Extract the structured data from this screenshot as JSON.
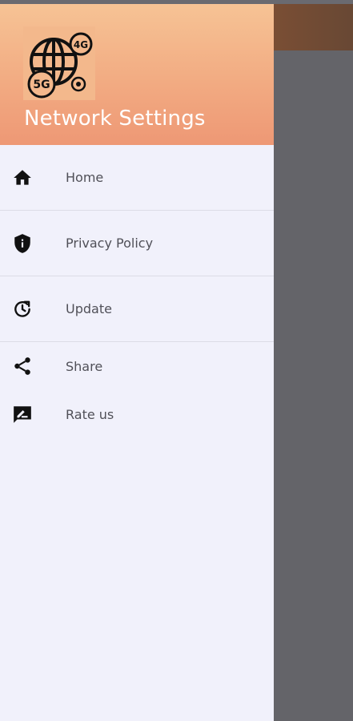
{
  "header": {
    "title": "Network Settings",
    "logo_badges": {
      "top": "4G",
      "bottom": "5G"
    },
    "gradient_top": "#f6c395",
    "gradient_bottom": "#ee9875"
  },
  "menu": {
    "items": [
      {
        "label": "Home",
        "icon": "home-icon"
      },
      {
        "label": "Privacy Policy",
        "icon": "shield-info-icon"
      },
      {
        "label": "Update",
        "icon": "update-clock-icon"
      },
      {
        "label": "Share",
        "icon": "share-icon"
      },
      {
        "label": "Rate us",
        "icon": "rate-review-icon"
      }
    ]
  },
  "colors": {
    "drawer_bg": "#f1f1fb",
    "scrim": "#646469",
    "label_text": "#505058"
  }
}
